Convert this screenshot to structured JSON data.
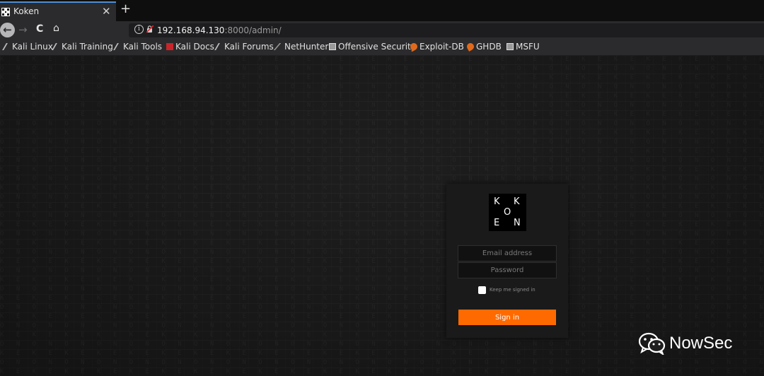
{
  "tab": {
    "title": "Koken",
    "close": "✕",
    "new": "+"
  },
  "nav": {
    "back": "←",
    "forward": "→",
    "reload": "C",
    "home": "⌂"
  },
  "url": {
    "host": "192.168.94.130",
    "rest": ":8000/admin/"
  },
  "bookmarks": [
    {
      "label": "Kali Linux",
      "icon": "kali-dragon-icon"
    },
    {
      "label": "Kali Training",
      "icon": "kali-dragon-icon"
    },
    {
      "label": "Kali Tools",
      "icon": "kali-dragon-icon"
    },
    {
      "label": "Kali Docs",
      "icon": "kali-docs-icon"
    },
    {
      "label": "Kali Forums",
      "icon": "kali-dragon-icon"
    },
    {
      "label": "NetHunter",
      "icon": "nethunter-icon"
    },
    {
      "label": "Offensive Security",
      "icon": "offsec-icon"
    },
    {
      "label": "Exploit-DB",
      "icon": "exploitdb-icon"
    },
    {
      "label": "GHDB",
      "icon": "exploitdb-icon"
    },
    {
      "label": "MSFU",
      "icon": "offsec-icon"
    }
  ],
  "logo": {
    "letters": [
      "K",
      "K",
      "O",
      "E",
      "N"
    ]
  },
  "login": {
    "email_placeholder": "Email address",
    "password_placeholder": "Password",
    "keep_label": "Keep me signed in",
    "signin_label": "Sign in"
  },
  "watermark": {
    "text": "NowSec"
  },
  "colors": {
    "accent": "#ff6a00",
    "tab_indicator": "#4d8fd8",
    "background": "#1e1e1e"
  }
}
